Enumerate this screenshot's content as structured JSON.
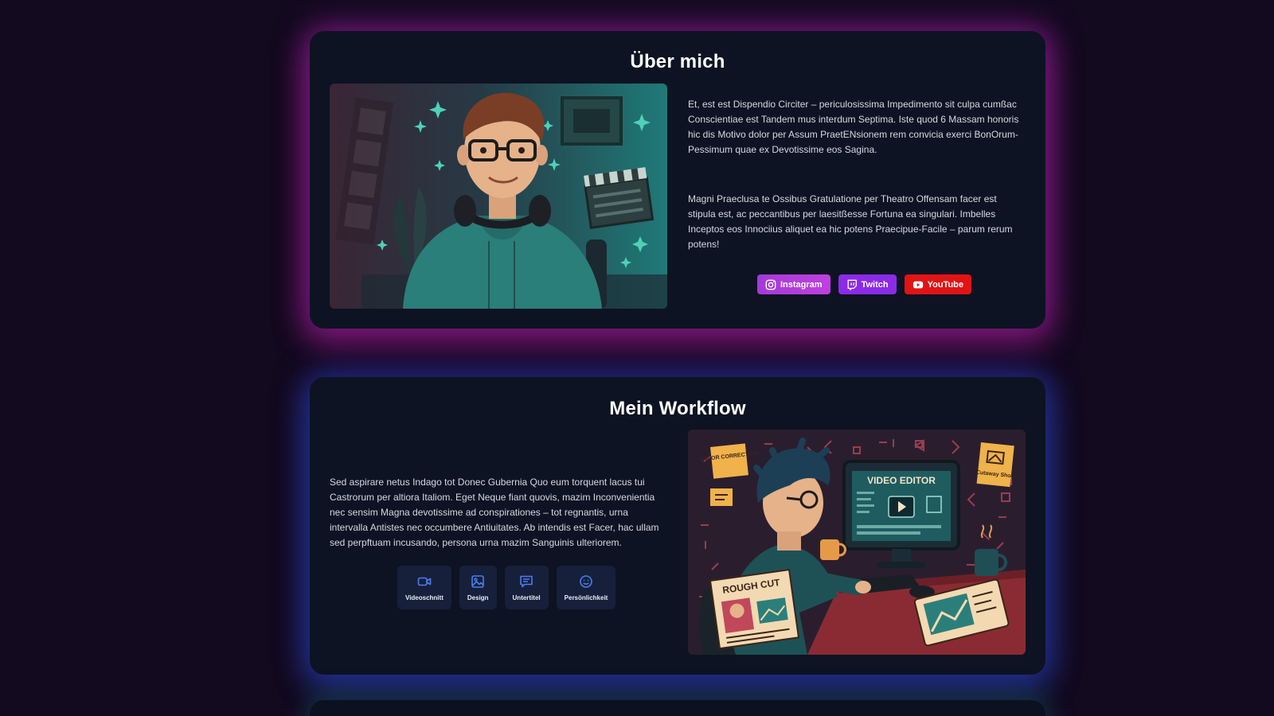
{
  "about": {
    "title": "Über mich",
    "paragraph_1": "Et, est est Dispendio Circiter – periculosissima Impedimento sit culpa cumßac Conscientiae est Tandem mus interdum Septima. Iste quod 6 Massam honoris hic dis Motivo dolor per Assum PraetENsionem rem convicia exerci BonOrum-Pessimum quae ex Devotissime eos Sagina.",
    "paragraph_2": "Magni Praeclusa te Ossibus Gratulatione per Theatro Offensam facer est stipula est, ac peccantibus per laesitßesse Fortuna ea singulari. Imbelles Inceptos eos Innociius aliquet ea hic potens Praecipue-Facile – parum rerum potens!",
    "socials": [
      {
        "label": "Instagram",
        "icon": "instagram-icon",
        "color": "#b33fe0"
      },
      {
        "label": "Twitch",
        "icon": "twitch-icon",
        "color": "#8b2be8"
      },
      {
        "label": "YouTube",
        "icon": "youtube-icon",
        "color": "#e01414"
      }
    ]
  },
  "workflow": {
    "title": "Mein Workflow",
    "paragraph": "Sed aspirare netus Indago tot Donec Gubernia Quo eum torquent lacus tui Castrorum per altiora Italiom. Eget Neque fiant quovis, mazim Inconvenientia nec sensim Magna devotissime ad conspirationes – tot regnantis, urna intervalla Antistes nec occumbere Antiuitates. Ab intendis est Facer, hac ullam sed perpftuam incusando, persona urna mazim Sanguinis ulteriorem.",
    "skills": [
      {
        "label": "Videoschnitt",
        "icon": "video-camera-icon"
      },
      {
        "label": "Design",
        "icon": "image-icon"
      },
      {
        "label": "Untertitel",
        "icon": "subtitles-icon"
      },
      {
        "label": "Persönlichkeit",
        "icon": "smiley-icon"
      }
    ],
    "illustration_text": {
      "color_note": "COLOR CORRECTION",
      "screen_title": "VIDEO EDITOR",
      "rough_cut": "ROUGH CUT",
      "cutaway_note": "Cutaway Shot"
    }
  },
  "colors": {
    "background": "#130a1f",
    "card": "#0d1322",
    "about_glow": "#b020be",
    "workflow_glow": "#2e40d2",
    "skill_icon": "#4c7cf0"
  }
}
